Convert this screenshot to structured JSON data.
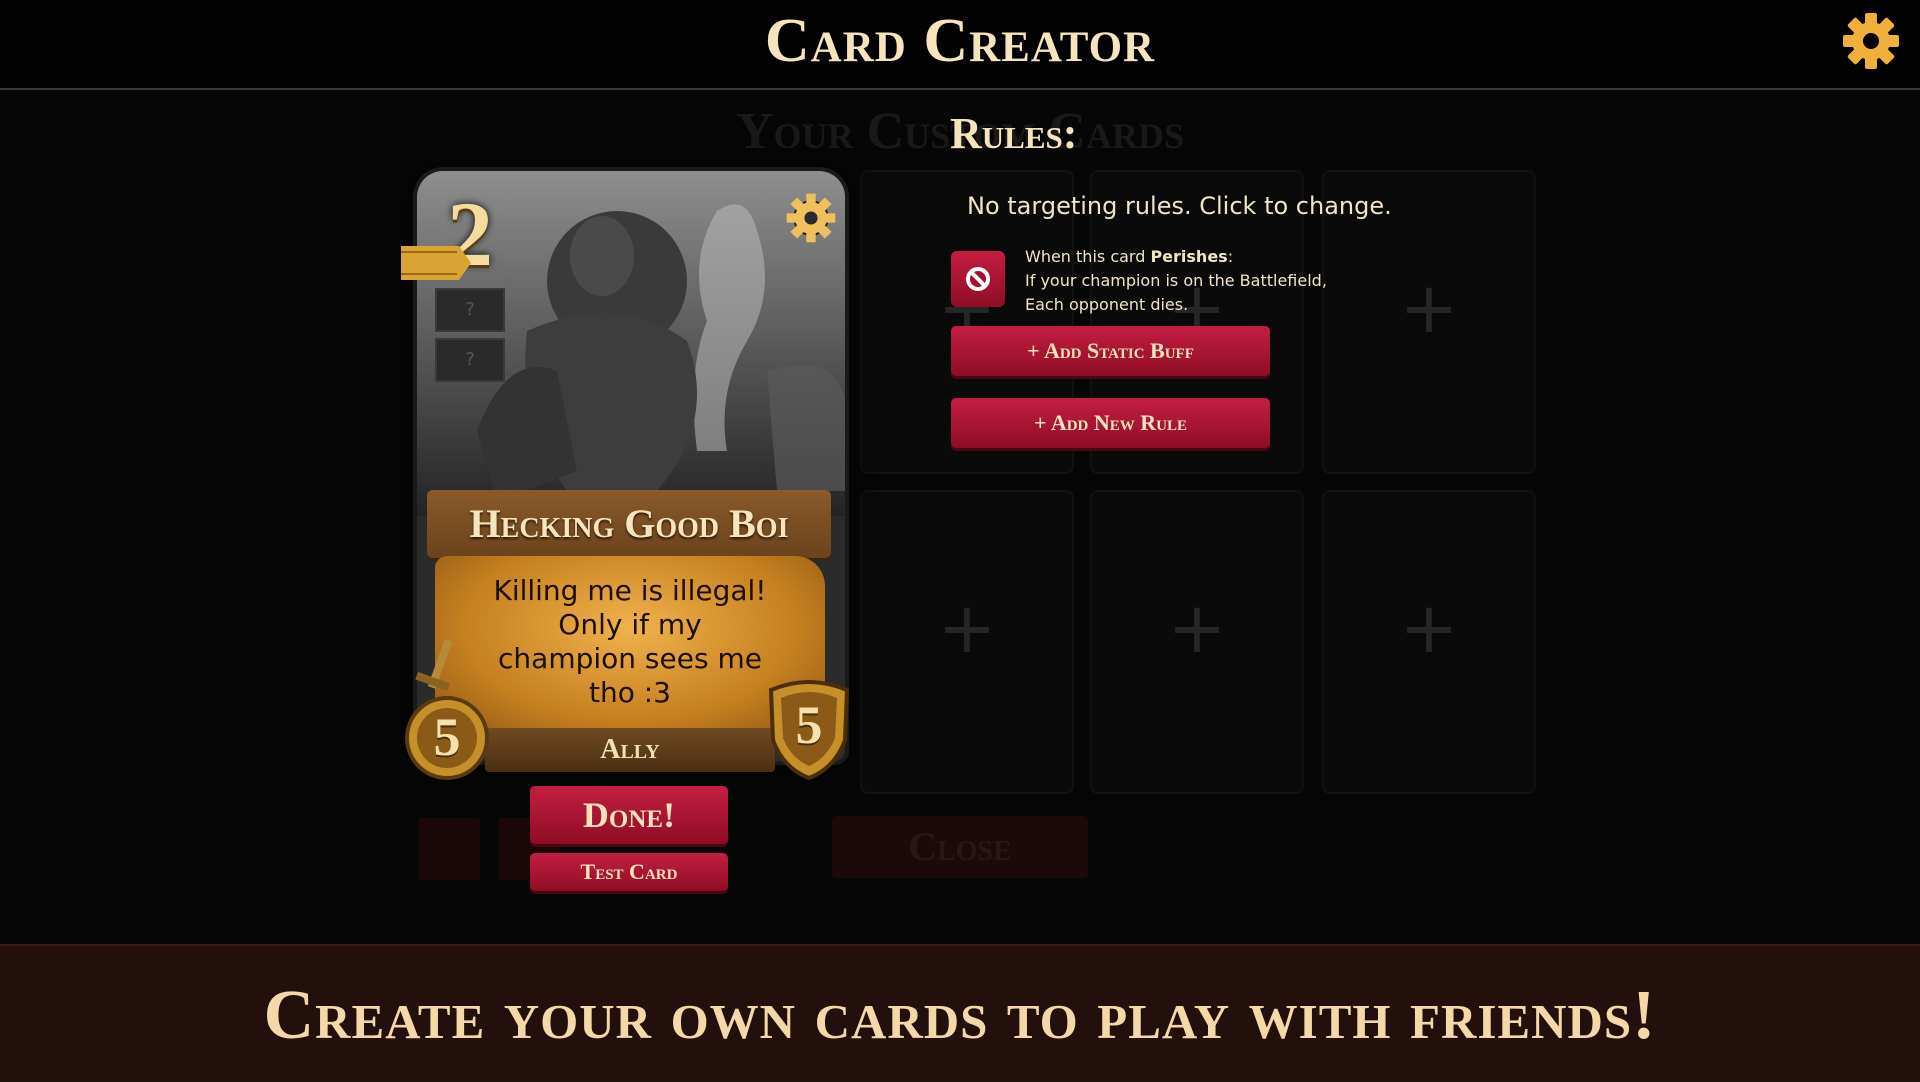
{
  "header": {
    "title": "Card Creator",
    "settings_icon": "gear-icon"
  },
  "background": {
    "title": "Your Custom Cards",
    "close_label": "Close"
  },
  "card": {
    "cost": "2",
    "name": "Hecking Good Boi",
    "text_lines": [
      "Killing me is illegal!",
      "Only if my",
      "champion sees me",
      "tho :3"
    ],
    "type": "Ally",
    "attack": "5",
    "defense": "5",
    "slot_placeholder_1": "?",
    "slot_placeholder_2": "?",
    "icons": {
      "settings": "gear-icon",
      "ribbon": "gold-ribbon-icon",
      "attack": "sword-medallion-icon",
      "defense": "shield-icon"
    }
  },
  "actions": {
    "done": "Done!",
    "test": "Test Card"
  },
  "rules": {
    "heading": "Rules:",
    "targeting": "No targeting rules. Click to change.",
    "rule_1": {
      "trigger_prefix": "When this card ",
      "trigger_keyword": "Perishes",
      "trigger_suffix": ":",
      "condition": "If your champion is on the Battlefield,",
      "effect": "Each opponent dies.",
      "icon": "prohibited-icon"
    },
    "add_static_buff": "+ Add Static Buff",
    "add_new_rule": "+ Add New Rule"
  },
  "footer": {
    "tagline": "Create your own cards to play with friends!"
  },
  "colors": {
    "accent_red": "#b3173a",
    "gold": "#f4d8a8",
    "footer_bg": "#230f0c"
  }
}
